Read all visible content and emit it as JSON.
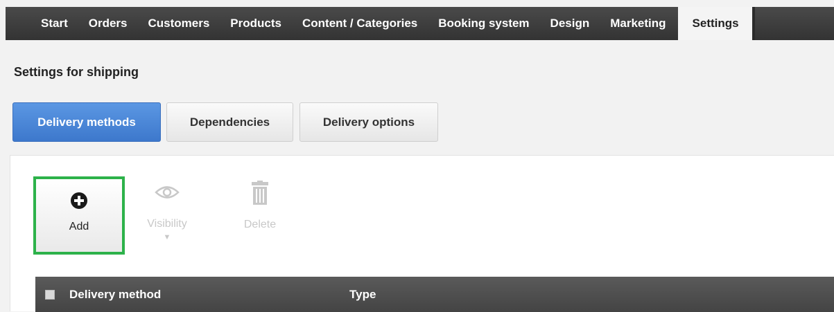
{
  "nav": {
    "items": [
      {
        "label": "Start"
      },
      {
        "label": "Orders"
      },
      {
        "label": "Customers"
      },
      {
        "label": "Products"
      },
      {
        "label": "Content / Categories"
      },
      {
        "label": "Booking system"
      },
      {
        "label": "Design"
      },
      {
        "label": "Marketing"
      },
      {
        "label": "Settings",
        "active": true
      }
    ]
  },
  "page": {
    "title": "Settings for shipping"
  },
  "tabs": [
    {
      "label": "Delivery methods",
      "active": true
    },
    {
      "label": "Dependencies"
    },
    {
      "label": "Delivery options"
    }
  ],
  "toolbar": {
    "add_label": "Add",
    "visibility_label": "Visibility",
    "delete_label": "Delete"
  },
  "table": {
    "columns": [
      "Delivery method",
      "Type"
    ]
  },
  "colors": {
    "highlight_border": "#2db24a",
    "primary_tab": "#3d78cc",
    "nav_bg": "#3a3a3a"
  }
}
